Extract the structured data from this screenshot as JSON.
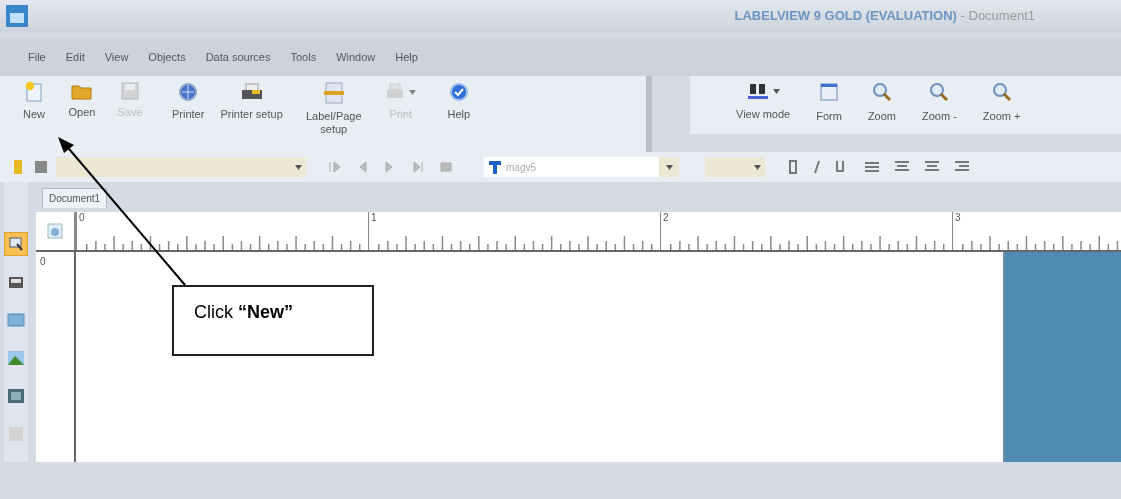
{
  "window": {
    "title": "LABELVIEW 9 GOLD (EVALUATION)",
    "document": " - Document1"
  },
  "menu": [
    "File",
    "Edit",
    "View",
    "Objects",
    "Data sources",
    "Tools",
    "Window",
    "Help"
  ],
  "toolbar": [
    {
      "label": "New",
      "kind": "new",
      "disabled": false,
      "dropdown": false
    },
    {
      "label": "Open",
      "kind": "open",
      "disabled": false,
      "dropdown": false
    },
    {
      "label": "Save",
      "kind": "save",
      "disabled": true,
      "dropdown": false
    },
    {
      "label": "Printer",
      "kind": "printer",
      "disabled": false,
      "dropdown": false
    },
    {
      "label": "Printer setup",
      "kind": "setup",
      "disabled": false,
      "dropdown": false
    },
    {
      "label": "Label/Page setup",
      "kind": "page",
      "disabled": false,
      "dropdown": false
    },
    {
      "label": "Print",
      "kind": "print",
      "disabled": true,
      "dropdown": true
    },
    {
      "label": "Help",
      "kind": "help",
      "disabled": false,
      "dropdown": false
    }
  ],
  "view_toolbar": [
    {
      "label": "View mode",
      "kind": "view",
      "dropdown": true
    },
    {
      "label": "Form",
      "kind": "form",
      "dropdown": false
    },
    {
      "label": "Zoom",
      "kind": "zoom",
      "dropdown": false
    },
    {
      "label": "Zoom -",
      "kind": "zoom",
      "dropdown": false
    },
    {
      "label": "Zoom +",
      "kind": "zoom",
      "dropdown": false
    }
  ],
  "format_bar": {
    "font": "magv5"
  },
  "tabs": [
    {
      "label": "Document1",
      "selected": true
    }
  ],
  "ruler": {
    "horizontal": [
      "0",
      "1",
      "2",
      "3"
    ],
    "vertical": [
      "0"
    ]
  },
  "left_tools": [
    {
      "kind": "select",
      "selected": true
    },
    {
      "kind": "barcode",
      "selected": false
    },
    {
      "kind": "text",
      "selected": false
    },
    {
      "kind": "image",
      "selected": false
    },
    {
      "kind": "film",
      "selected": false
    },
    {
      "kind": "blank",
      "selected": false
    }
  ],
  "callout": {
    "text": "Click **“New”**"
  }
}
